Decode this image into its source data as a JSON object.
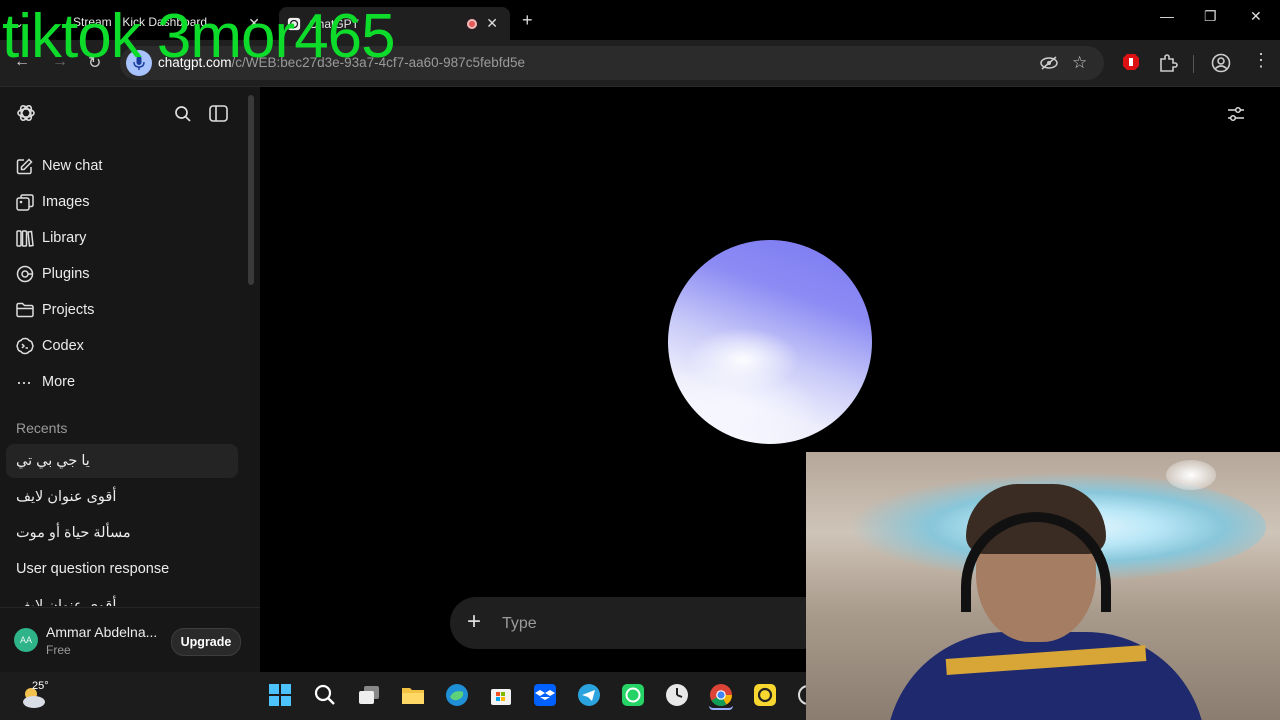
{
  "browser": {
    "tabs": [
      {
        "title": "Stream - Kick Dashboard",
        "active": false
      },
      {
        "title": "ChatGPT",
        "active": true
      }
    ],
    "new_tab_icon": "plus-icon",
    "url_host": "chatgpt.com",
    "url_path": "/c/WEB:bec27d3e-93a7-4cf7-aa60-987c5febfd5e"
  },
  "overlay": {
    "watermark": "tiktok 3mor465"
  },
  "sidebar": {
    "nav": [
      {
        "label": "New chat",
        "icon": "edit-icon"
      },
      {
        "label": "Images",
        "icon": "images-icon"
      },
      {
        "label": "Library",
        "icon": "library-icon"
      },
      {
        "label": "Plugins",
        "icon": "plugins-icon"
      },
      {
        "label": "Projects",
        "icon": "folder-icon"
      },
      {
        "label": "Codex",
        "icon": "codex-icon"
      },
      {
        "label": "More",
        "icon": "more-icon"
      }
    ],
    "recents_heading": "Recents",
    "recents": [
      {
        "title": "يا جي بي تي",
        "rtl": true
      },
      {
        "title": "أقوى عنوان لايف",
        "rtl": true
      },
      {
        "title": "مسألة حياة أو موت",
        "rtl": true
      },
      {
        "title": "User question response",
        "rtl": false
      },
      {
        "title": "أقوى عنوان لايف",
        "rtl": true
      }
    ],
    "user": {
      "initials": "AA",
      "name": "Ammar Abdelna...",
      "plan": "Free",
      "upgrade_label": "Upgrade"
    }
  },
  "main": {
    "composer_placeholder": "Type"
  },
  "taskbar": {
    "temperature": "25°",
    "apps": [
      "start",
      "search",
      "task-view",
      "file-explorer",
      "edge",
      "store",
      "dropbox",
      "telegram",
      "whatsapp",
      "clock",
      "chrome",
      "app-yellow",
      "app-partial"
    ]
  },
  "colors": {
    "watermark": "#0edc2b",
    "sidebar_bg": "#171717",
    "main_bg": "#000000",
    "avatar": "#2fb389",
    "orb_top": "#7a78f2"
  }
}
